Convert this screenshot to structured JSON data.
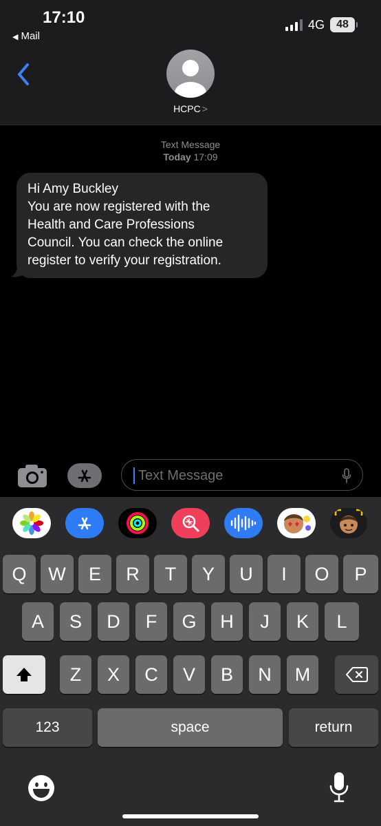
{
  "status_bar": {
    "time": "17:10",
    "back_app": "Mail",
    "network": "4G",
    "battery": "48"
  },
  "conversation": {
    "contact_name": "HCPC",
    "contact_chevron": ">"
  },
  "message_meta": {
    "type": "Text Message",
    "date": "Today",
    "time": "17:09"
  },
  "message": {
    "lines": [
      "Hi Amy Buckley",
      "You are now registered with the",
      "Health and Care Professions",
      "Council. You can check the online",
      "register to verify your registration."
    ]
  },
  "compose": {
    "placeholder": "Text Message"
  },
  "app_strip": [
    "photos-app",
    "app-store-app",
    "activity-app",
    "search-images-app",
    "audio-message-app",
    "memoji-stickers-app",
    "memoji-app"
  ],
  "keyboard": {
    "row1": [
      "Q",
      "W",
      "E",
      "R",
      "T",
      "Y",
      "U",
      "I",
      "O",
      "P"
    ],
    "row2": [
      "A",
      "S",
      "D",
      "F",
      "G",
      "H",
      "J",
      "K",
      "L"
    ],
    "row3": [
      "Z",
      "X",
      "C",
      "V",
      "B",
      "N",
      "M"
    ],
    "numbers_label": "123",
    "space_label": "space",
    "return_label": "return"
  },
  "colors": {
    "accent": "#3a82f7",
    "bubble": "#262629",
    "header": "#1c1c1e",
    "keyboard": "#2b2b2d"
  }
}
